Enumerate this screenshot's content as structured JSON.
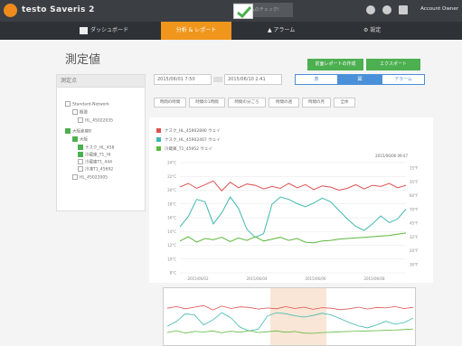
{
  "app": {
    "title": "testo Saveris 2",
    "status": "システムのチェック!",
    "account": "Account Owner"
  },
  "nav": {
    "dashboard": "ダッシュボード",
    "reports": "分析 & レポート",
    "alarms": "アラーム",
    "settings": "設定"
  },
  "page": {
    "title": "測定値"
  },
  "actions": {
    "create": "前面レポートの作成",
    "export": "エクスポート"
  },
  "panel": {
    "title": "測定点"
  },
  "tree": [
    {
      "label": "Standard-Network",
      "checked": false
    },
    {
      "label": "概要",
      "checked": false
    },
    {
      "label": "HL_45022035",
      "checked": false
    },
    {
      "label": "大阪倉庫B",
      "checked": true
    },
    {
      "label": "大阪",
      "checked": true
    },
    {
      "label": "ナスク_HL_458",
      "checked": true
    },
    {
      "label": "冷蔵庫_T1_HI",
      "checked": true
    },
    {
      "label": "冷蔵庫T1_444",
      "checked": false
    },
    {
      "label": "冷凍T1_45692",
      "checked": false
    },
    {
      "label": "HL_45022005",
      "checked": false
    }
  ],
  "dates": {
    "from": "2015/06/01 7:50",
    "to": "2015/06/10 2:41"
  },
  "view_toggle": [
    "表",
    "図",
    "アラーム"
  ],
  "ranges": [
    "時間の時間",
    "時間の1時間",
    "時間の分ごろ",
    "時間の週",
    "時間の月",
    "全体"
  ],
  "chart_data": {
    "type": "line",
    "series": [
      {
        "name": "ナスク_HL_45902890 ウェイ",
        "color": "#e05050",
        "values": [
          20.0,
          20.6,
          19.8,
          20.4,
          21.0,
          19.4,
          20.8,
          19.9,
          20.5,
          20.3,
          19.7,
          20.1,
          19.8,
          20.6,
          19.9,
          20.4,
          19.6,
          20.2,
          20.0,
          19.5,
          19.8,
          20.4,
          19.7,
          20.3,
          20.1,
          20.6,
          19.9,
          20.3
        ]
      },
      {
        "name": "ナスク_HL_45902467 ウェイ",
        "color": "#3fb8b0",
        "values": [
          13.5,
          15.2,
          18.0,
          17.6,
          14.0,
          15.8,
          18.4,
          16.5,
          13.1,
          11.8,
          12.4,
          17.2,
          18.4,
          18.0,
          17.3,
          16.8,
          17.4,
          18.2,
          17.6,
          16.2,
          14.8,
          13.6,
          12.9,
          14.0,
          15.3,
          14.2,
          14.8,
          16.4
        ]
      },
      {
        "name": "冷蔵庫_T1_45952 ウェイ",
        "color": "#5cb83c",
        "values": [
          11.2,
          11.9,
          11.0,
          11.6,
          11.4,
          11.8,
          11.1,
          11.7,
          11.3,
          11.9,
          11.2,
          11.5,
          11.8,
          11.3,
          11.6,
          11.0,
          10.9,
          11.2,
          11.3,
          11.5,
          11.6,
          11.7,
          11.8,
          11.9,
          12.0,
          12.1,
          12.3,
          12.5
        ]
      }
    ],
    "x": [
      "2015/06/02",
      "2015/06/04",
      "2015/06/06",
      "2015/06/08"
    ],
    "ylim": [
      6,
      24
    ],
    "yticks_left": [
      "24°C",
      "22°C",
      "20°C",
      "18°C",
      "16°C",
      "14°C",
      "12°C",
      "10°C",
      "8°C"
    ],
    "yticks_right": [
      "15°F",
      "35°F",
      "60°F",
      "70°F",
      "45°F",
      "32°F",
      "20°F",
      "30°F"
    ],
    "timestamp_label": "2015/06/06 09:47"
  }
}
